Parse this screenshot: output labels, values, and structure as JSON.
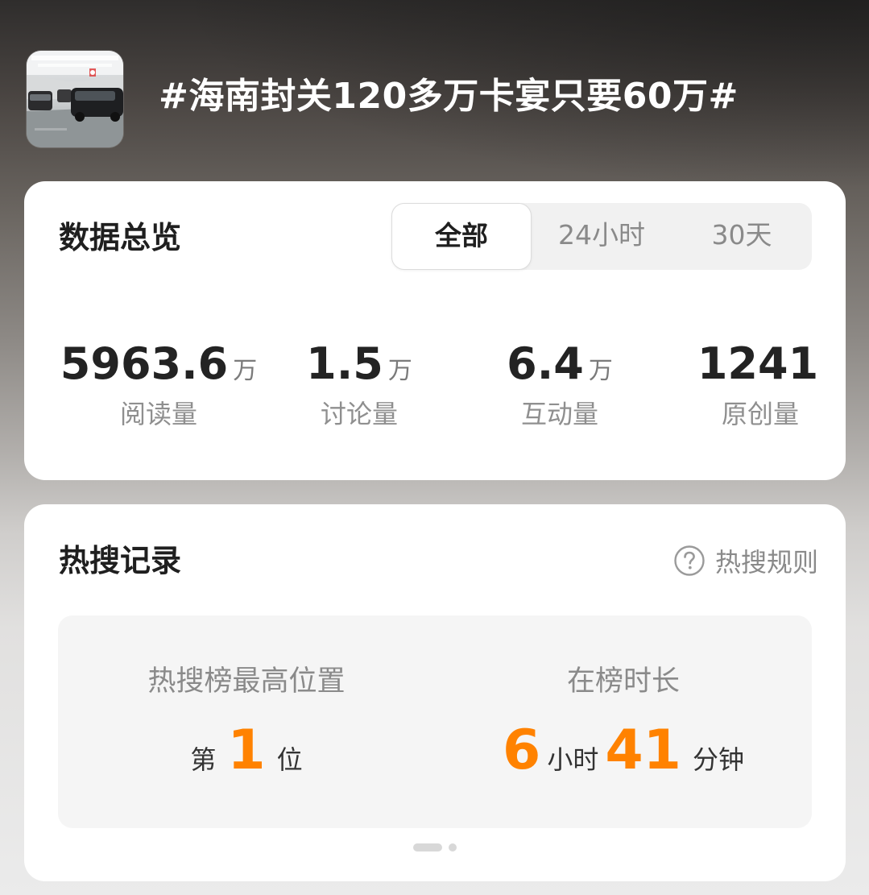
{
  "header": {
    "topic_title": "#海南封关120多万卡宴只要60万#",
    "thumbnail": "topic-cover-image"
  },
  "overview": {
    "title": "数据总览",
    "tabs": [
      {
        "label": "全部",
        "selected": true
      },
      {
        "label": "24小时",
        "selected": false
      },
      {
        "label": "30天",
        "selected": false
      }
    ],
    "stats": [
      {
        "value": "5963.6",
        "unit": "万",
        "label": "阅读量"
      },
      {
        "value": "1.5",
        "unit": "万",
        "label": "讨论量"
      },
      {
        "value": "6.4",
        "unit": "万",
        "label": "互动量"
      },
      {
        "value": "1241",
        "unit": "",
        "label": "原创量"
      }
    ]
  },
  "hot_search": {
    "title": "热搜记录",
    "rule_link": "热搜规则",
    "rule_icon": "question-circle-icon",
    "highest_position": {
      "label": "热搜榜最高位置",
      "prefix": "第",
      "value": "1",
      "suffix": "位"
    },
    "duration": {
      "label": "在榜时长",
      "hours": "6",
      "hours_unit": "小时",
      "minutes": "41",
      "minutes_unit": "分钟"
    },
    "pager": {
      "pages": 2,
      "current": 1
    }
  },
  "colors": {
    "accent": "#ff8200",
    "card_bg": "#ffffff",
    "panel_bg": "#f5f5f5",
    "muted_text": "#8f8f8f"
  }
}
